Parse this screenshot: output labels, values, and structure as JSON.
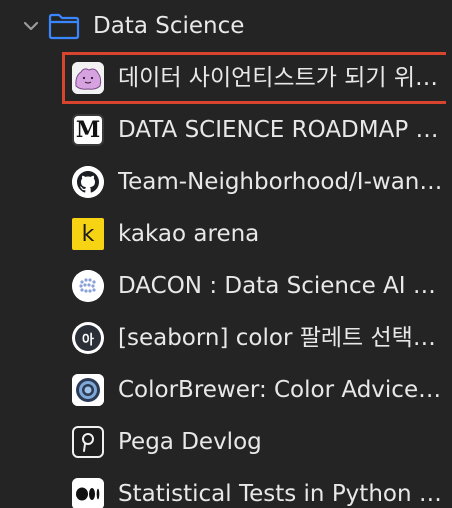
{
  "folder": {
    "label": "Data Science",
    "chevron_icon": "chevron-down-icon",
    "folder_icon": "folder-icon",
    "folder_color": "#3a86ff"
  },
  "bookmarks": [
    {
      "label": "데이터 사이언티스트가 되기 위한 로드맵",
      "icon": "ditto-pokemon-icon",
      "selected": true
    },
    {
      "label": "DATA SCIENCE ROADMAP — Medium",
      "icon": "medium-m-icon"
    },
    {
      "label": "Team-Neighborhood/I-want-to-study-Data-Science",
      "icon": "github-icon"
    },
    {
      "label": "kakao arena",
      "icon": "kakao-k-icon"
    },
    {
      "label": "DACON : Data Science AI Competition",
      "icon": "dacon-icon"
    },
    {
      "label": "[seaborn] color 팔레트 선택하기",
      "icon": "ah-icon"
    },
    {
      "label": "ColorBrewer: Color Advice for Maps",
      "icon": "colorbrewer-icon"
    },
    {
      "label": "Pega Devlog",
      "icon": "pega-p-icon"
    },
    {
      "label": "Statistical Tests in Python Cheatsheet",
      "icon": "medium-dots-icon"
    }
  ],
  "colors": {
    "background": "#242424",
    "selection_border": "#d9442f",
    "text": "#e8e8e8",
    "kakao_yellow": "#f7d413"
  }
}
